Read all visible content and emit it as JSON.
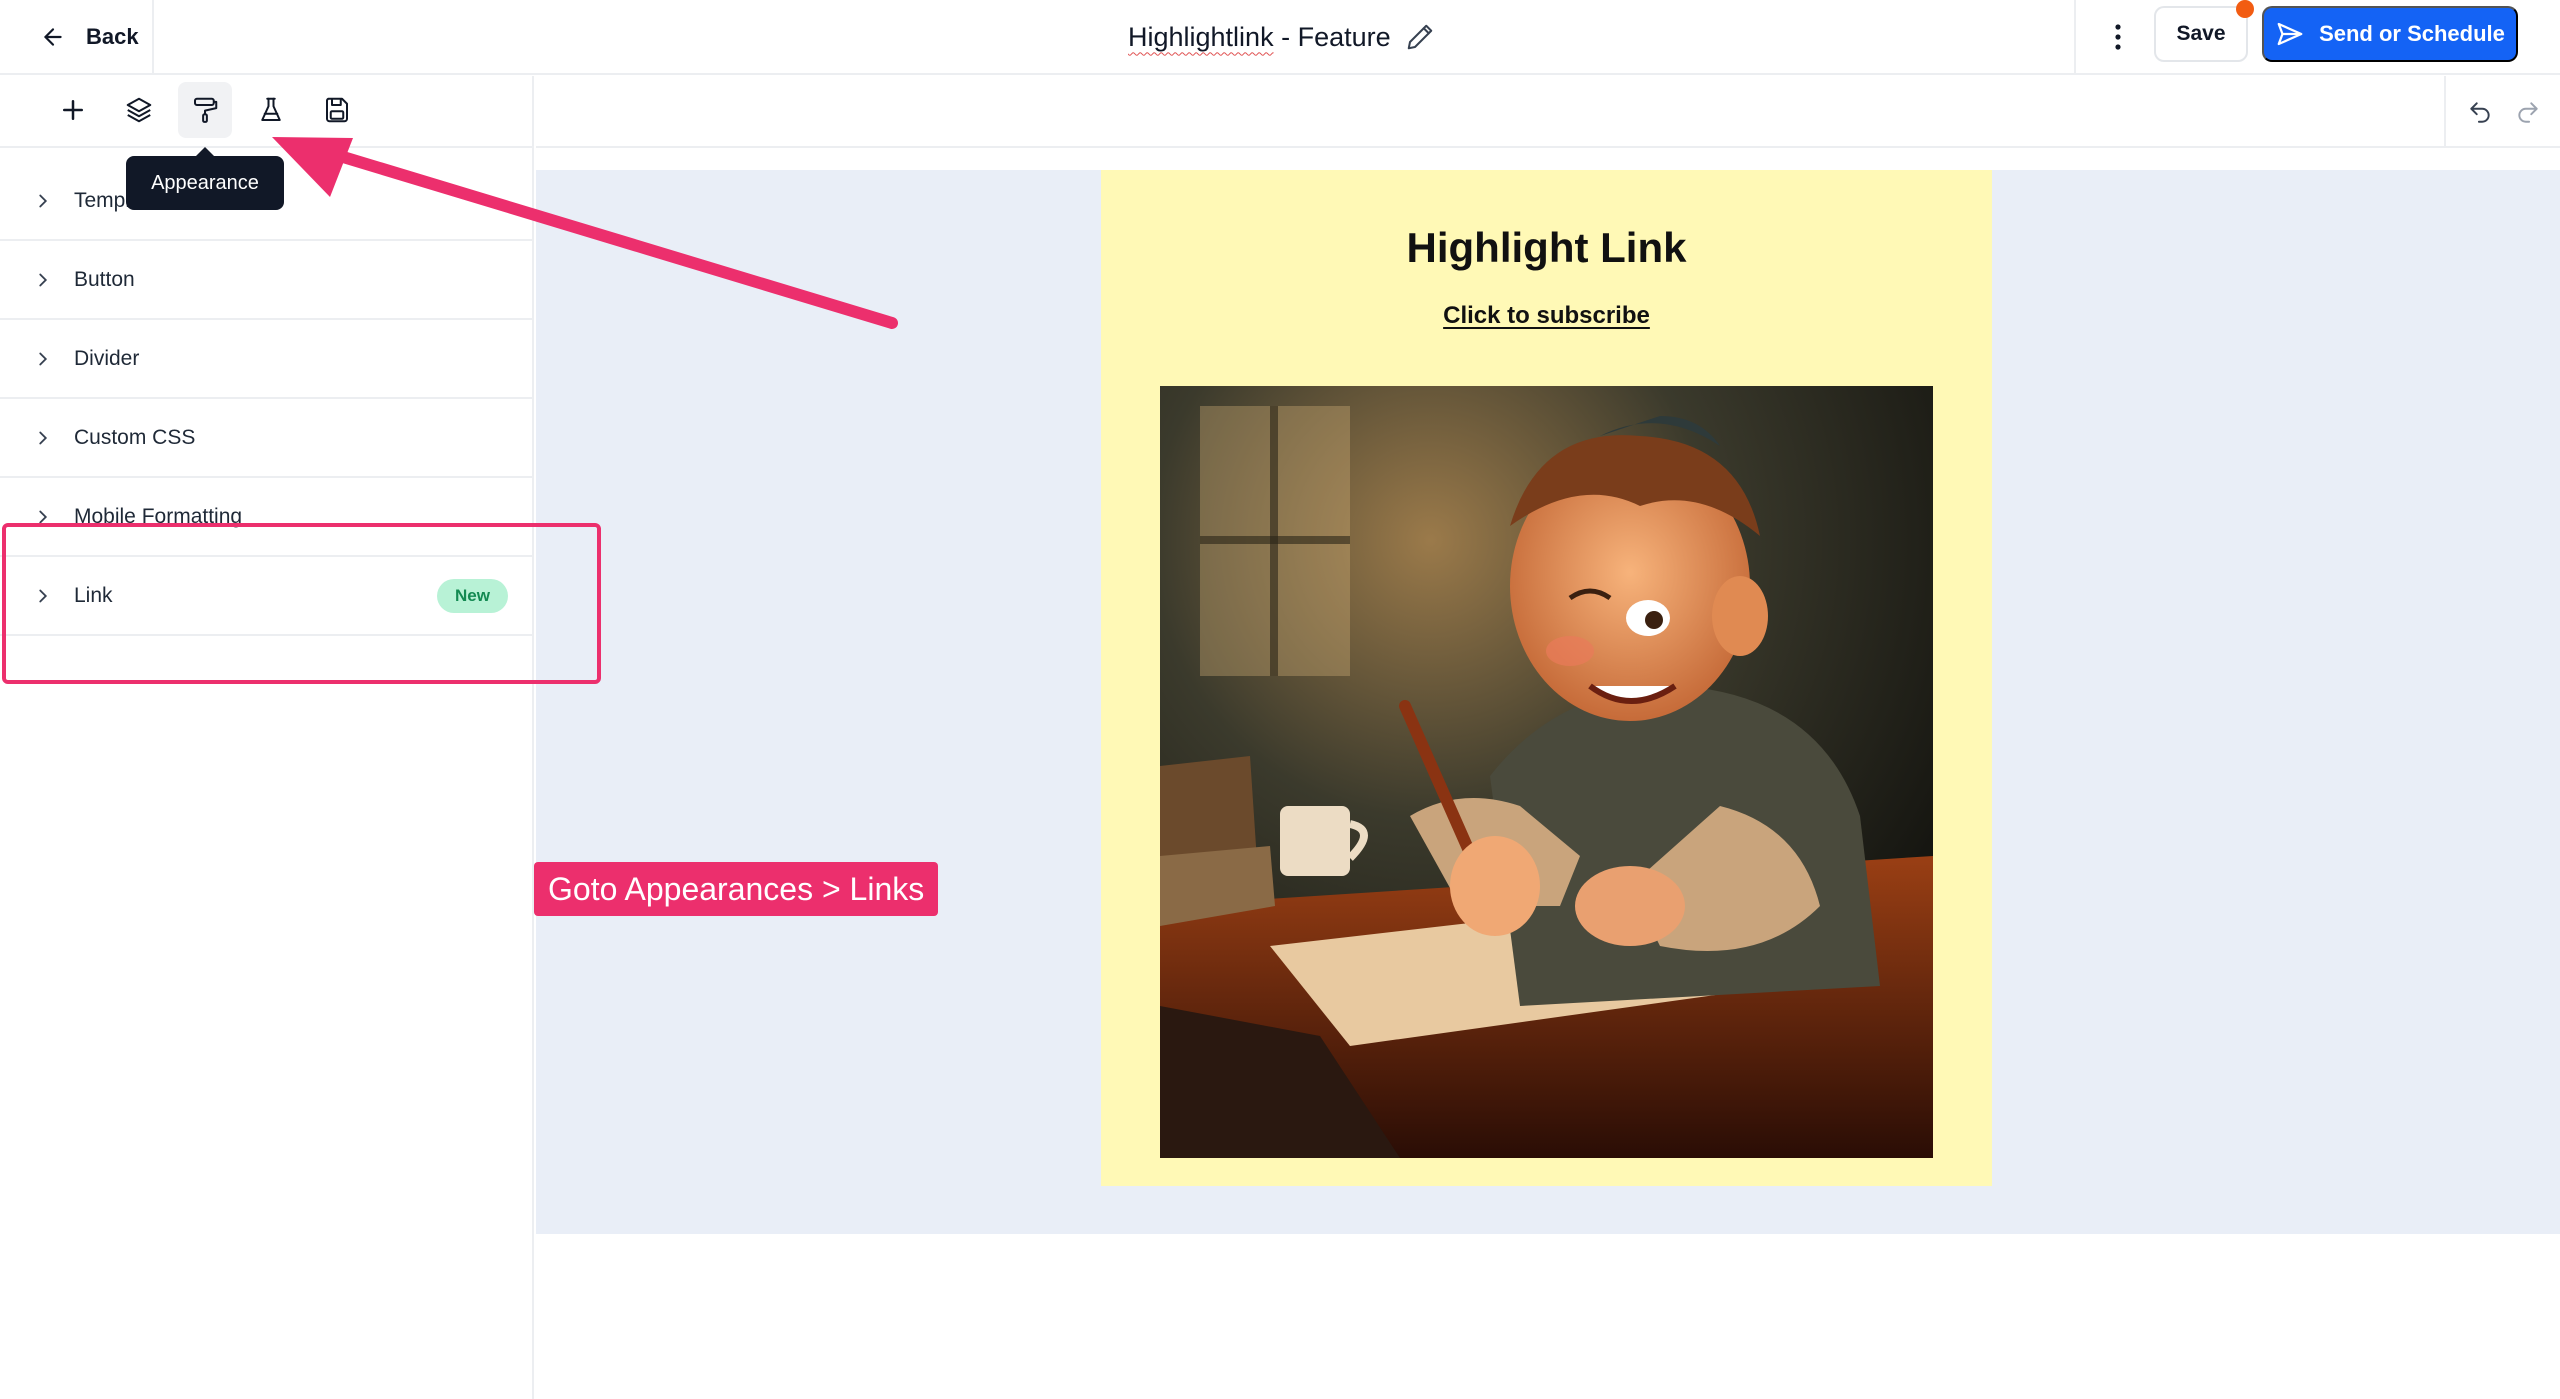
{
  "header": {
    "back_label": "Back",
    "title_part1": "Highlightlink",
    "title_part2": " - Feature",
    "save_label": "Save",
    "send_label": "Send or Schedule",
    "colors": {
      "primary": "#1463f5",
      "notification_dot": "#f25c12"
    }
  },
  "sidebar": {
    "tools": [
      {
        "name": "add-icon"
      },
      {
        "name": "layers-icon"
      },
      {
        "name": "paint-roller-icon",
        "active": true
      },
      {
        "name": "flask-icon"
      },
      {
        "name": "save-disk-icon"
      }
    ],
    "tooltip": "Appearance",
    "items": [
      {
        "label": "Template"
      },
      {
        "label": "Button"
      },
      {
        "label": "Divider"
      },
      {
        "label": "Custom CSS"
      },
      {
        "label": "Mobile Formatting"
      },
      {
        "label": "Link",
        "badge": "New"
      }
    ]
  },
  "canvas": {
    "background": "#e9eef7",
    "email": {
      "background": "#fff9b6",
      "title": "Highlight Link",
      "link_text": "Click to subscribe",
      "image_description": "cartoon-boy-writing-illustration"
    }
  },
  "annotation": {
    "label": "Goto Appearances > Links",
    "color": "#ec2f6d"
  }
}
